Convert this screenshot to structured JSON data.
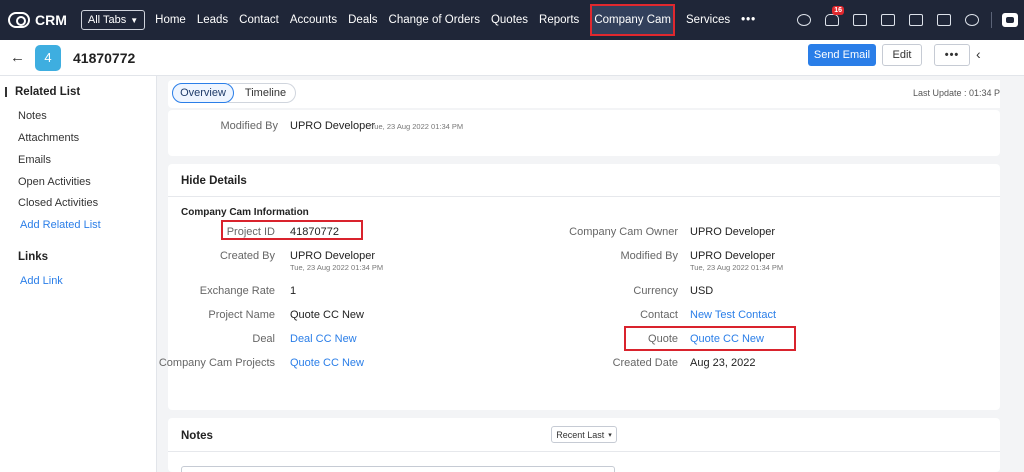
{
  "nav": {
    "logo_text": "CRM",
    "all_tabs": "All Tabs",
    "links": [
      "Home",
      "Leads",
      "Contact",
      "Accounts",
      "Deals",
      "Change of Orders",
      "Quotes",
      "Reports",
      "Company Cam",
      "Services"
    ],
    "active_link": "Company Cam",
    "more": "•••",
    "notification_count": "16",
    "icons": [
      "search-icon",
      "bell-icon",
      "calendar-add-icon",
      "calendar-icon",
      "mail-icon",
      "store-icon",
      "gear-icon",
      "user-avatar-icon"
    ]
  },
  "record": {
    "back": "←",
    "avatar_text": "4",
    "title": "41870772",
    "send_email": "Send Email",
    "edit": "Edit",
    "more": "•••",
    "collapse": "‹"
  },
  "sidebar": {
    "related_list_title": "Related List",
    "items": [
      "Notes",
      "Attachments",
      "Emails",
      "Open Activities",
      "Closed Activities"
    ],
    "add_related_list": "Add Related List",
    "links_title": "Links",
    "add_link": "Add Link"
  },
  "tabs": {
    "overview": "Overview",
    "timeline": "Timeline",
    "last_update": "Last Update : 01:34 P"
  },
  "summary": {
    "modified_by_label": "Modified By",
    "modified_by_value": "UPRO Developer",
    "modified_by_time": "Tue, 23 Aug 2022 01:34 PM"
  },
  "details": {
    "hide_details": "Hide Details",
    "section_title": "Company Cam Information",
    "left": [
      {
        "label": "Project ID",
        "value": "41870772"
      },
      {
        "label": "Created By",
        "value": "UPRO Developer",
        "sub": "Tue, 23 Aug 2022 01:34 PM"
      },
      {
        "label": "Exchange Rate",
        "value": "1"
      },
      {
        "label": "Project Name",
        "value": "Quote CC New"
      },
      {
        "label": "Deal",
        "value": "Deal CC New"
      },
      {
        "label": "Company Cam Projects",
        "value": "Quote CC New"
      }
    ],
    "right": [
      {
        "label": "Company Cam Owner",
        "value": "UPRO Developer"
      },
      {
        "label": "Modified By",
        "value": "UPRO Developer",
        "sub": "Tue, 23 Aug 2022 01:34 PM"
      },
      {
        "label": "Currency",
        "value": "USD"
      },
      {
        "label": "Contact",
        "value": "New Test Contact"
      },
      {
        "label": "Quote",
        "value": "Quote CC New"
      },
      {
        "label": "Created Date",
        "value": "Aug 23, 2022"
      }
    ]
  },
  "notes": {
    "title": "Notes",
    "sort": "Recent Last",
    "sort_caret": "▾"
  },
  "colors": {
    "nav_bg": "#1f2638",
    "accent": "#2a7ee8",
    "highlight": "#d9232d"
  }
}
